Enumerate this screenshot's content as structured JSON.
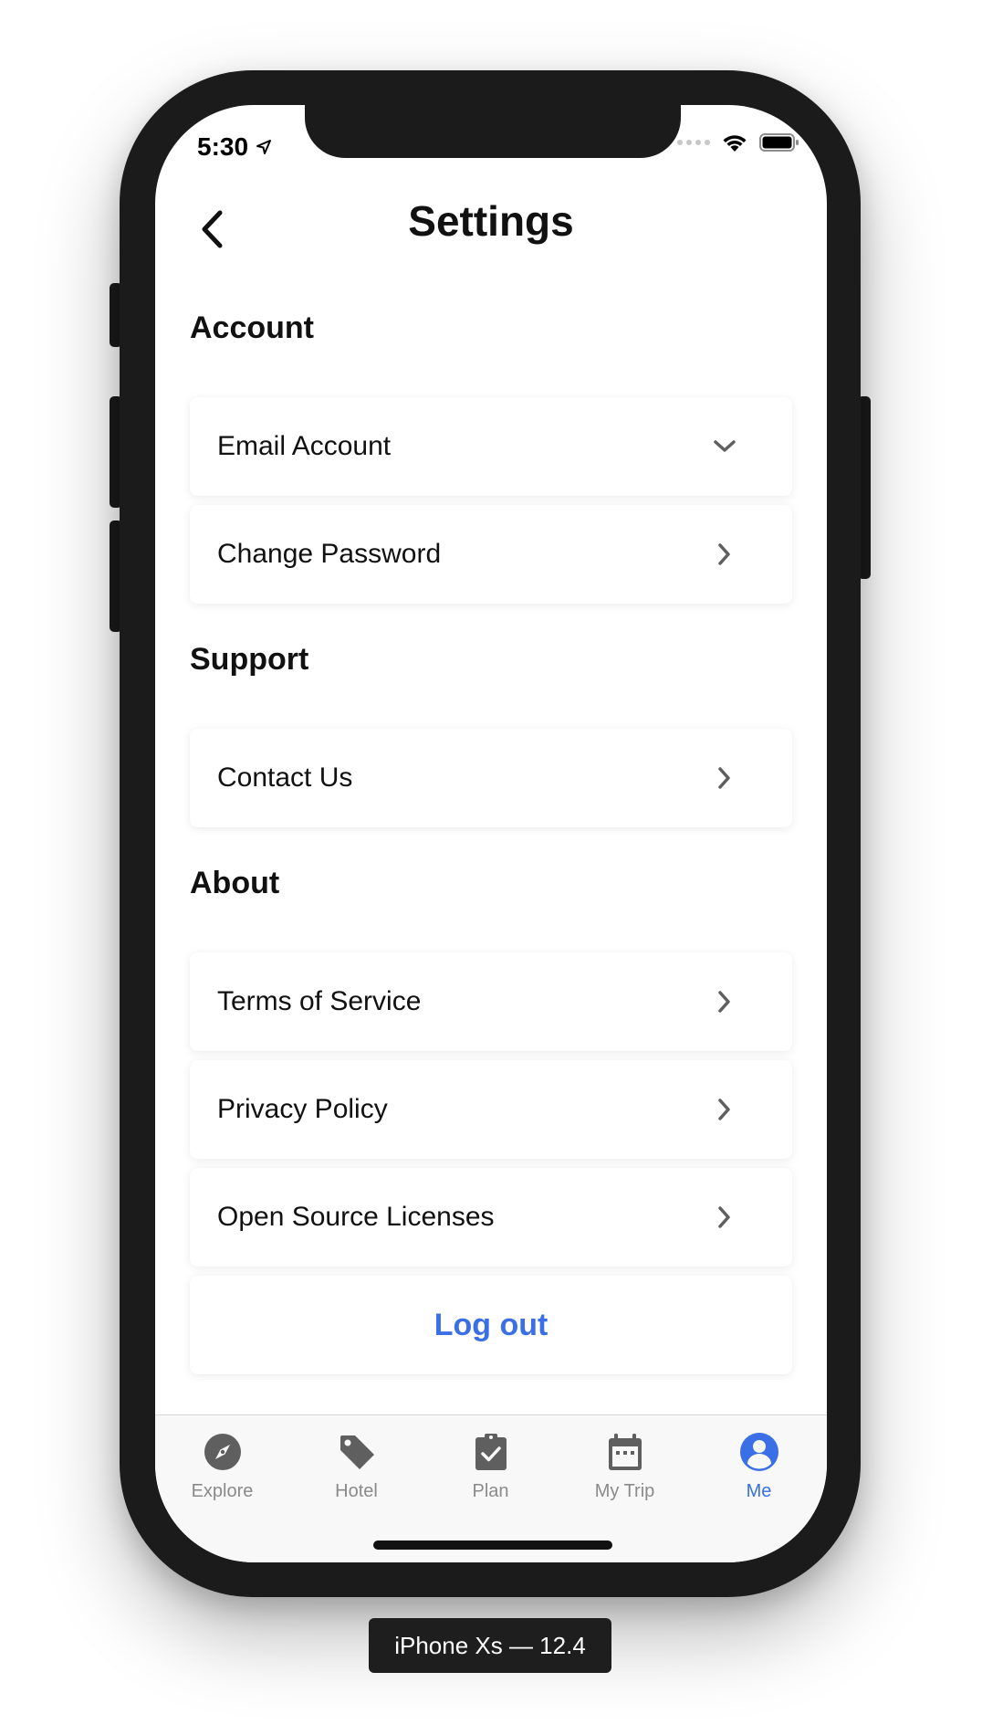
{
  "status_bar": {
    "time": "5:30"
  },
  "header": {
    "title": "Settings"
  },
  "sections": {
    "account": {
      "title": "Account",
      "items": [
        {
          "label": "Email Account",
          "icon": "chevron-down-icon"
        },
        {
          "label": "Change Password",
          "icon": "chevron-right-icon"
        }
      ]
    },
    "support": {
      "title": "Support",
      "items": [
        {
          "label": "Contact Us",
          "icon": "chevron-right-icon"
        }
      ]
    },
    "about": {
      "title": "About",
      "items": [
        {
          "label": "Terms of Service",
          "icon": "chevron-right-icon"
        },
        {
          "label": "Privacy Policy",
          "icon": "chevron-right-icon"
        },
        {
          "label": "Open Source Licenses",
          "icon": "chevron-right-icon"
        }
      ]
    }
  },
  "logout": {
    "label": "Log out"
  },
  "tabbar": {
    "items": [
      {
        "label": "Explore",
        "icon": "compass-icon"
      },
      {
        "label": "Hotel",
        "icon": "tag-icon"
      },
      {
        "label": "Plan",
        "icon": "clipboard-check-icon"
      },
      {
        "label": "My Trip",
        "icon": "calendar-icon"
      },
      {
        "label": "Me",
        "icon": "user-icon"
      }
    ],
    "active": "Me"
  },
  "device_label": "iPhone Xs — 12.4",
  "colors": {
    "accent": "#3a6fe8",
    "tab_inactive": "#8a8a8a",
    "icon_gray": "#5f5f5f"
  }
}
